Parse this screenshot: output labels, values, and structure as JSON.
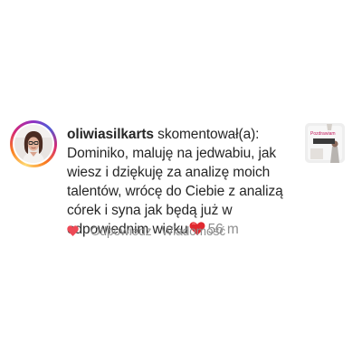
{
  "comment": {
    "username": "oliwiasilkarts",
    "action": "skomentował(a):",
    "text": "Dominiko, maluję na jedwabiu, jak wiesz i dziękuję za analizę moich talentów, wrócę do Ciebie z analizą córek i syna jak będą już w odpowiednim wieku",
    "emoji": "red-heart-emoji",
    "timestamp": "56 m"
  },
  "actions": {
    "like_icon": "heart-icon",
    "reply_label": "Odpowiedz",
    "message_label": "Wiadomość"
  },
  "post_thumbnail": {
    "label": "Pozdrawiam"
  },
  "colors": {
    "text": "#262626",
    "secondary": "#8e8e8e",
    "like": "#ed4956"
  }
}
